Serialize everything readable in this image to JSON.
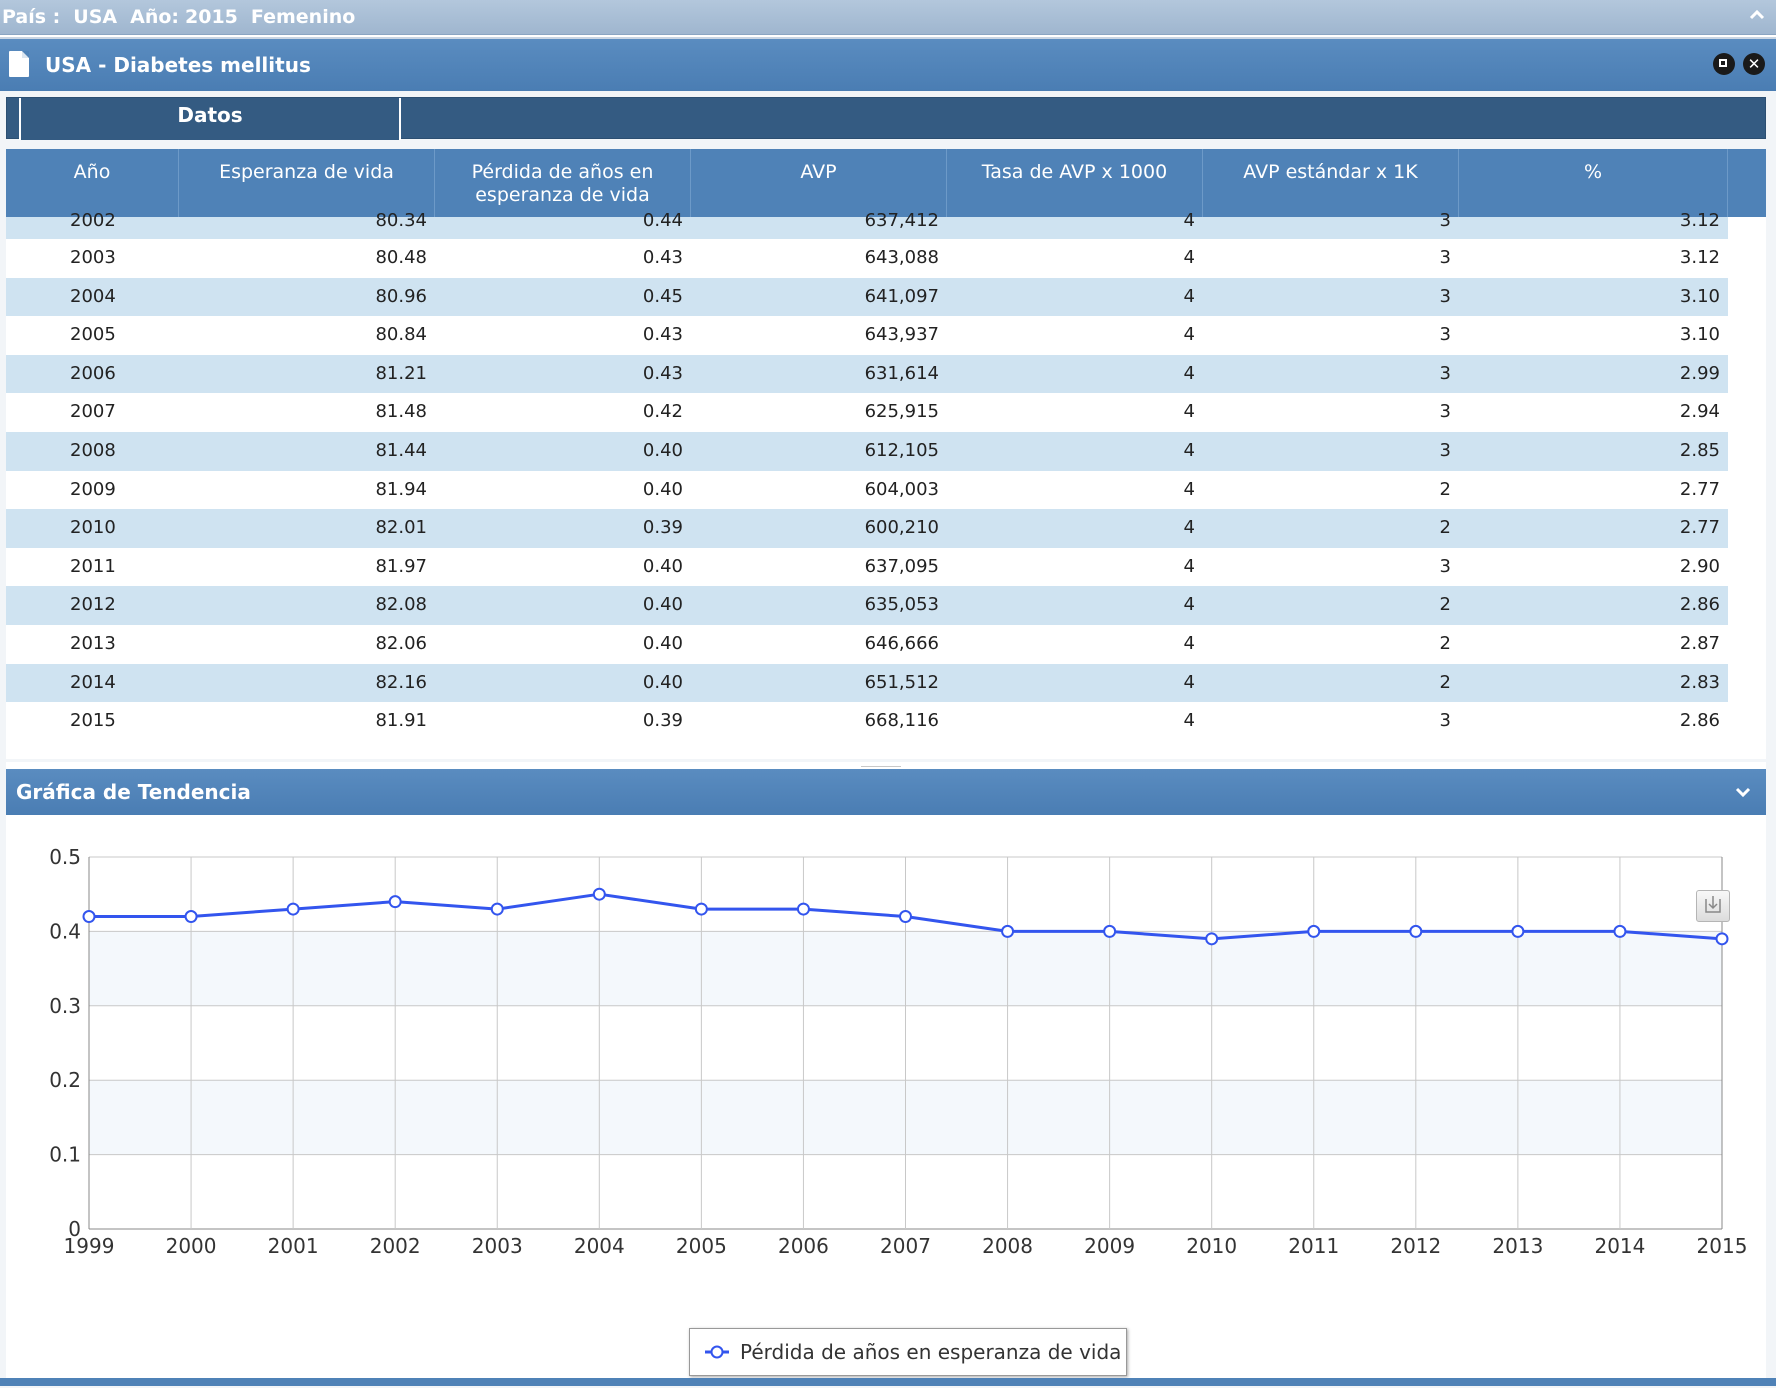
{
  "filter_bar": {
    "country_label": "País :",
    "country_value": "USA",
    "year_label": "Año:",
    "year_value": "2015",
    "sex_value": "Femenino",
    "collapse_icon": "chevron-up-icon"
  },
  "window": {
    "title": "USA - Diabetes mellitus",
    "maximize_icon": "maximize-icon",
    "close_icon": "close-icon"
  },
  "tabs": [
    {
      "label": "Datos",
      "active": true
    }
  ],
  "table": {
    "columns": [
      "Año",
      "Esperanza de vida",
      "Pérdida de años en esperanza de vida",
      "AVP",
      "Tasa de AVP x 1000",
      "AVP estándar x 1K",
      "%"
    ],
    "rows": [
      [
        "2002",
        "80.34",
        "0.44",
        "637,412",
        "4",
        "3",
        "3.12"
      ],
      [
        "2003",
        "80.48",
        "0.43",
        "643,088",
        "4",
        "3",
        "3.12"
      ],
      [
        "2004",
        "80.96",
        "0.45",
        "641,097",
        "4",
        "3",
        "3.10"
      ],
      [
        "2005",
        "80.84",
        "0.43",
        "643,937",
        "4",
        "3",
        "3.10"
      ],
      [
        "2006",
        "81.21",
        "0.43",
        "631,614",
        "4",
        "3",
        "2.99"
      ],
      [
        "2007",
        "81.48",
        "0.42",
        "625,915",
        "4",
        "3",
        "2.94"
      ],
      [
        "2008",
        "81.44",
        "0.40",
        "612,105",
        "4",
        "3",
        "2.85"
      ],
      [
        "2009",
        "81.94",
        "0.40",
        "604,003",
        "4",
        "2",
        "2.77"
      ],
      [
        "2010",
        "82.01",
        "0.39",
        "600,210",
        "4",
        "2",
        "2.77"
      ],
      [
        "2011",
        "81.97",
        "0.40",
        "637,095",
        "4",
        "3",
        "2.90"
      ],
      [
        "2012",
        "82.08",
        "0.40",
        "635,053",
        "4",
        "2",
        "2.86"
      ],
      [
        "2013",
        "82.06",
        "0.40",
        "646,666",
        "4",
        "2",
        "2.87"
      ],
      [
        "2014",
        "82.16",
        "0.40",
        "651,512",
        "4",
        "2",
        "2.83"
      ],
      [
        "2015",
        "81.91",
        "0.39",
        "668,116",
        "4",
        "3",
        "2.86"
      ]
    ]
  },
  "chart_panel": {
    "title": "Gráfica de Tendencia",
    "expand_icon": "chevron-down-icon",
    "download_icon": "download-icon"
  },
  "chart_data": {
    "type": "line",
    "x": [
      "1999",
      "2000",
      "2001",
      "2002",
      "2003",
      "2004",
      "2005",
      "2006",
      "2007",
      "2008",
      "2009",
      "2010",
      "2011",
      "2012",
      "2013",
      "2014",
      "2015"
    ],
    "series": [
      {
        "name": "Pérdida de años en esperanza de vida",
        "values": [
          0.42,
          0.42,
          0.43,
          0.44,
          0.43,
          0.45,
          0.43,
          0.43,
          0.42,
          0.4,
          0.4,
          0.39,
          0.4,
          0.4,
          0.4,
          0.4,
          0.39
        ],
        "color": "#3355ee"
      }
    ],
    "yticks": [
      "0",
      "0.1",
      "0.2",
      "0.3",
      "0.4",
      "0.5"
    ],
    "ylim": [
      0,
      0.5
    ],
    "grid": true,
    "legend_position": "bottom-center"
  },
  "colors": {
    "header_blue": "#4f82b7",
    "row_alt": "#cfe3f1",
    "tab_dark": "#345b82",
    "series_blue": "#3355ee"
  }
}
